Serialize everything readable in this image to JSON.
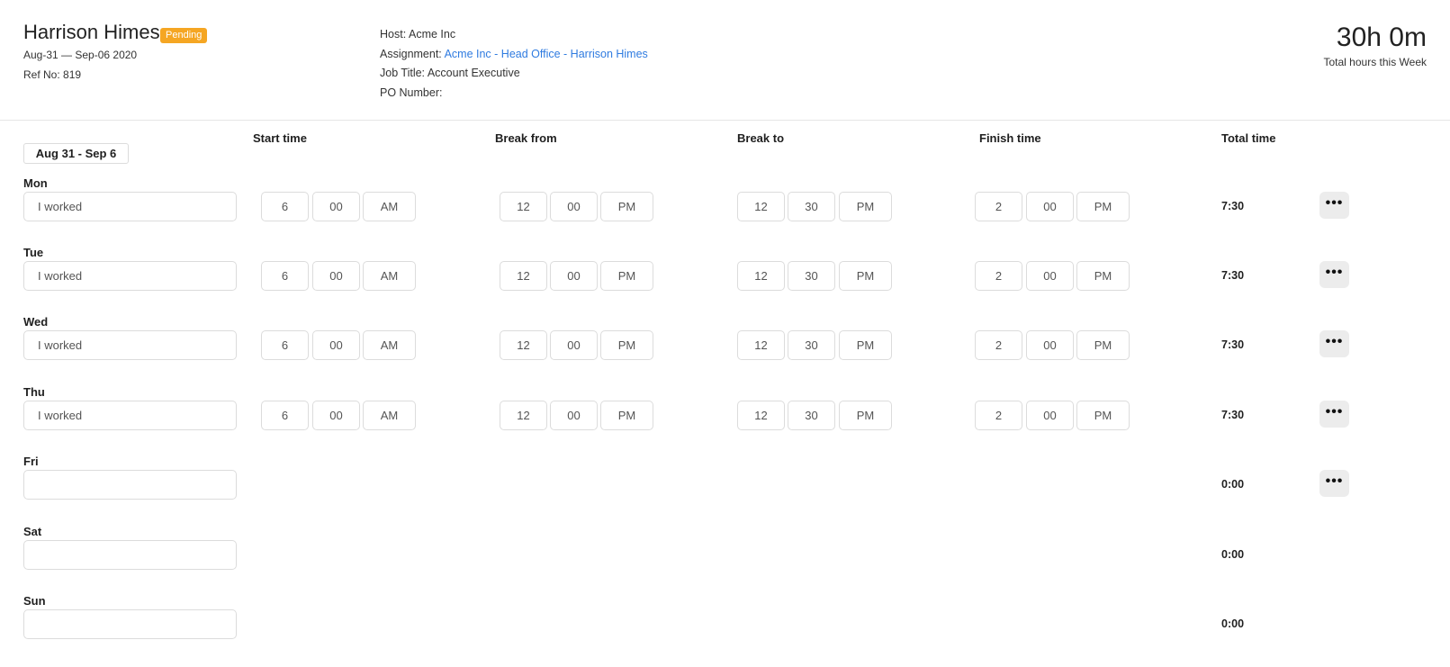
{
  "header": {
    "employee_name": "Harrison Himes",
    "status_badge": "Pending",
    "date_range": "Aug-31 — Sep-06 2020",
    "ref_no": "Ref No: 819",
    "host_label": "Host:",
    "host_value": "Acme Inc",
    "assignment_label": "Assignment:",
    "assignment_value": "Acme Inc - Head Office - Harrison Himes",
    "job_title_label": "Job Title:",
    "job_title_value": "Account Executive",
    "po_number_label": "PO Number:",
    "po_number_value": "",
    "total_hours": "30h 0m",
    "total_hours_caption": "Total hours this Week",
    "accent_color": "#f5a623",
    "link_color": "#2f7be0"
  },
  "columns": {
    "start": "Start time",
    "break_from": "Break from",
    "break_to": "Break to",
    "finish": "Finish time",
    "total": "Total time"
  },
  "week_tab": "Aug 31 - Sep 6",
  "days": [
    {
      "day": "Mon",
      "note": "I worked",
      "start": [
        "6",
        "00",
        "AM"
      ],
      "break_from": [
        "12",
        "00",
        "PM"
      ],
      "break_to": [
        "12",
        "30",
        "PM"
      ],
      "finish": [
        "2",
        "00",
        "PM"
      ],
      "total": "7:30",
      "more": "•••"
    },
    {
      "day": "Tue",
      "note": "I worked",
      "start": [
        "6",
        "00",
        "AM"
      ],
      "break_from": [
        "12",
        "00",
        "PM"
      ],
      "break_to": [
        "12",
        "30",
        "PM"
      ],
      "finish": [
        "2",
        "00",
        "PM"
      ],
      "total": "7:30",
      "more": "•••"
    },
    {
      "day": "Wed",
      "note": "I worked",
      "start": [
        "6",
        "00",
        "AM"
      ],
      "break_from": [
        "12",
        "00",
        "PM"
      ],
      "break_to": [
        "12",
        "30",
        "PM"
      ],
      "finish": [
        "2",
        "00",
        "PM"
      ],
      "total": "7:30",
      "more": "•••"
    },
    {
      "day": "Thu",
      "note": "I worked",
      "start": [
        "6",
        "00",
        "AM"
      ],
      "break_from": [
        "12",
        "00",
        "PM"
      ],
      "break_to": [
        "12",
        "30",
        "PM"
      ],
      "finish": [
        "2",
        "00",
        "PM"
      ],
      "total": "7:30",
      "more": "•••"
    },
    {
      "day": "Fri",
      "note": "",
      "total": "0:00",
      "more": "•••"
    },
    {
      "day": "Sat",
      "note": "",
      "total": "0:00"
    },
    {
      "day": "Sun",
      "note": "",
      "total": "0:00"
    }
  ]
}
